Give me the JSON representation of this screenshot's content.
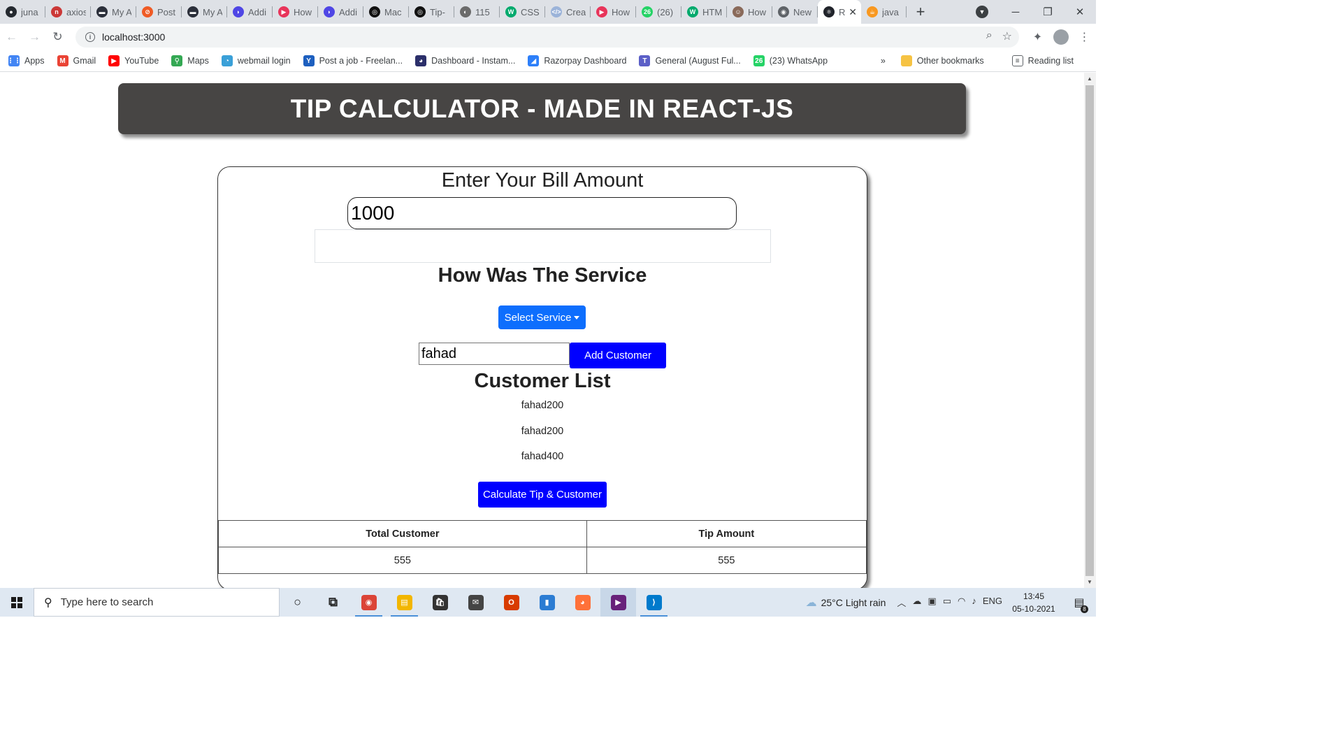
{
  "browser": {
    "tabs": [
      {
        "title": "juna",
        "color": "#24292f",
        "glyph": "●"
      },
      {
        "title": "axios",
        "color": "#cb3837",
        "glyph": "n"
      },
      {
        "title": "My A",
        "color": "#2b2f3a",
        "glyph": "▬"
      },
      {
        "title": "Post",
        "color": "#ef5b25",
        "glyph": "⊘"
      },
      {
        "title": "My A",
        "color": "#2b2f3a",
        "glyph": "▬"
      },
      {
        "title": "Addi",
        "color": "#4f46e5",
        "glyph": "◗"
      },
      {
        "title": "How",
        "color": "#e8345a",
        "glyph": "▶"
      },
      {
        "title": "Addi",
        "color": "#4f46e5",
        "glyph": "◗"
      },
      {
        "title": "Mac",
        "color": "#111",
        "glyph": "◎"
      },
      {
        "title": "Tip-",
        "color": "#111",
        "glyph": "◎"
      },
      {
        "title": "115",
        "color": "#6b6b6b",
        "glyph": "◐"
      },
      {
        "title": "CSS",
        "color": "#04aa6d",
        "glyph": "W"
      },
      {
        "title": "Crea",
        "color": "#9bb3d9",
        "glyph": "</>"
      },
      {
        "title": "How",
        "color": "#e8345a",
        "glyph": "▶"
      },
      {
        "title": "(26)",
        "color": "#25d366",
        "glyph": "26"
      },
      {
        "title": "HTM",
        "color": "#04aa6d",
        "glyph": "W"
      },
      {
        "title": "How",
        "color": "#8a6a5a",
        "glyph": "☺"
      },
      {
        "title": "New",
        "color": "#5f6368",
        "glyph": "◉"
      },
      {
        "title": "R",
        "color": "#20232a",
        "glyph": "⚛",
        "active": true
      },
      {
        "title": "java",
        "color": "#f89820",
        "glyph": "☕"
      }
    ],
    "url": "localhost:3000",
    "bookmarks": [
      {
        "label": "Apps",
        "color": "#4285f4",
        "glyph": "⋮⋮"
      },
      {
        "label": "Gmail",
        "color": "#ea4335",
        "glyph": "M"
      },
      {
        "label": "YouTube",
        "color": "#ff0000",
        "glyph": "▶"
      },
      {
        "label": "Maps",
        "color": "#34a853",
        "glyph": "⚲"
      },
      {
        "label": "webmail login",
        "color": "#3aa0d8",
        "glyph": "◔"
      },
      {
        "label": "Post a job - Freelan...",
        "color": "#1d5fbf",
        "glyph": "Y"
      },
      {
        "label": "Dashboard - Instam...",
        "color": "#2b2f6a",
        "glyph": "◕"
      },
      {
        "label": "Razorpay Dashboard",
        "color": "#2d7ff9",
        "glyph": "◢"
      },
      {
        "label": "General (August Ful...",
        "color": "#5b5fc7",
        "glyph": "T"
      },
      {
        "label": "(23) WhatsApp",
        "color": "#25d366",
        "glyph": "26"
      }
    ],
    "bookmarks_overflow": "»",
    "other_bookmarks": "Other bookmarks",
    "reading_list": "Reading list"
  },
  "app": {
    "header_title": "TIP CALCULATOR - MADE IN REACT-JS",
    "bill_heading": "Enter Your Bill Amount",
    "bill_value": "1000",
    "service_heading": "How Was The Service",
    "service_button": "Select Service",
    "customer_input_value": "fahad",
    "add_customer_button": "Add Customer",
    "customer_list_heading": "Customer List",
    "customers": [
      "fahad200",
      "fahad200",
      "fahad400"
    ],
    "calculate_button": "Calculate Tip & Customer",
    "table": {
      "headers": [
        "Total Customer",
        "Tip Amount"
      ],
      "row": [
        "555",
        "555"
      ]
    },
    "colors": {
      "banner": "#474544",
      "primary": "#0d6efd",
      "blue_button": "#0000ff"
    }
  },
  "taskbar": {
    "search_placeholder": "Type here to search",
    "weather": "25°C  Light rain",
    "language": "ENG",
    "time": "13:45",
    "date": "05-10-2021",
    "notification_count": "8",
    "apps": [
      {
        "name": "cortana",
        "color": "#222",
        "glyph": "○"
      },
      {
        "name": "task-view",
        "color": "#222",
        "glyph": "⧉"
      },
      {
        "name": "chrome",
        "color": "#db4437",
        "glyph": "◉",
        "open": true
      },
      {
        "name": "file-explorer",
        "color": "#f2b600",
        "glyph": "▤",
        "open": true
      },
      {
        "name": "store",
        "color": "#333",
        "glyph": "🛍"
      },
      {
        "name": "mail",
        "color": "#444",
        "glyph": "✉"
      },
      {
        "name": "office",
        "color": "#d83b01",
        "glyph": "O"
      },
      {
        "name": "files-app",
        "color": "#2b7cd3",
        "glyph": "▮"
      },
      {
        "name": "firefox",
        "color": "#ff7139",
        "glyph": "◕"
      },
      {
        "name": "visual-studio",
        "color": "#68217a",
        "glyph": "▶",
        "highlight": true
      },
      {
        "name": "vscode",
        "color": "#007acc",
        "glyph": "⟩",
        "open": true
      }
    ]
  }
}
